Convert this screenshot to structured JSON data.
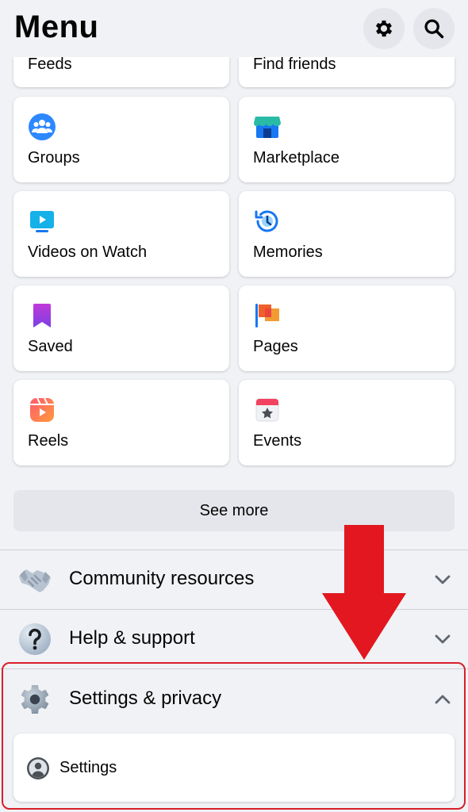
{
  "header": {
    "title": "Menu",
    "settings_icon": "gear-icon",
    "search_icon": "search-icon"
  },
  "shortcuts": [
    {
      "label": "Feeds",
      "icon": "feeds-icon"
    },
    {
      "label": "Find friends",
      "icon": "find-friends-icon"
    },
    {
      "label": "Groups",
      "icon": "groups-icon"
    },
    {
      "label": "Marketplace",
      "icon": "marketplace-icon"
    },
    {
      "label": "Videos on Watch",
      "icon": "watch-icon"
    },
    {
      "label": "Memories",
      "icon": "memories-icon"
    },
    {
      "label": "Saved",
      "icon": "saved-icon"
    },
    {
      "label": "Pages",
      "icon": "pages-icon"
    },
    {
      "label": "Reels",
      "icon": "reels-icon"
    },
    {
      "label": "Events",
      "icon": "events-icon"
    }
  ],
  "see_more_label": "See more",
  "sections": [
    {
      "label": "Community resources",
      "icon": "handshake-icon",
      "expanded": false
    },
    {
      "label": "Help & support",
      "icon": "question-icon",
      "expanded": false
    },
    {
      "label": "Settings & privacy",
      "icon": "gear-icon",
      "expanded": true
    }
  ],
  "settings_item": {
    "label": "Settings",
    "icon": "profile-icon"
  },
  "colors": {
    "background": "#f0f2f5",
    "card": "#ffffff",
    "button": "#e4e6eb",
    "annotation_red": "#e2171f",
    "facebook_blue": "#1877f2"
  }
}
